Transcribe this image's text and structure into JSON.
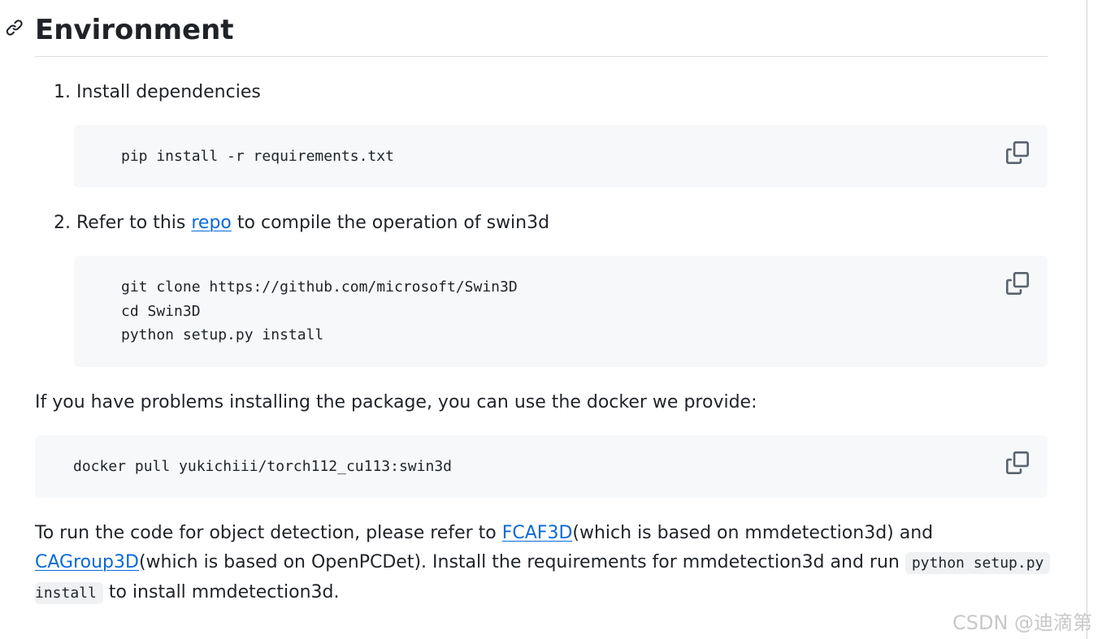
{
  "heading": {
    "title": "Environment",
    "anchor_icon": "link-icon"
  },
  "steps": [
    {
      "number": "1.",
      "text": "Install dependencies",
      "code": "pip install -r requirements.txt"
    },
    {
      "number": "2.",
      "text_before": "Refer to this",
      "link": "repo",
      "text_after": "to compile the operation of swin3d",
      "code": "git clone https://github.com/microsoft/Swin3D\ncd Swin3D\npython setup.py install"
    }
  ],
  "docker": {
    "text": "If you have problems installing the package, you can use the docker we provide:",
    "code": "docker pull yukichiii/torch112_cu113:swin3d"
  },
  "closing": {
    "line1_before": "To run the code for object detection, please refer to",
    "link1": "FCAF3D",
    "line1_after": "(which is based on mmdetection3d) and",
    "link2": "CAGroup3D",
    "line2_after": "(which is based on OpenPCDet). Install the requirements for mmdetection3d and run",
    "inline_code_1": "python setup.py",
    "inline_code_2": "install",
    "line3_after": "to install mmdetection3d."
  },
  "copy_icon": "copy-icon",
  "watermark": "CSDN @迪滴第",
  "colors": {
    "link": "#0969da",
    "code_bg": "#f6f8fa",
    "text": "#1f2328"
  }
}
